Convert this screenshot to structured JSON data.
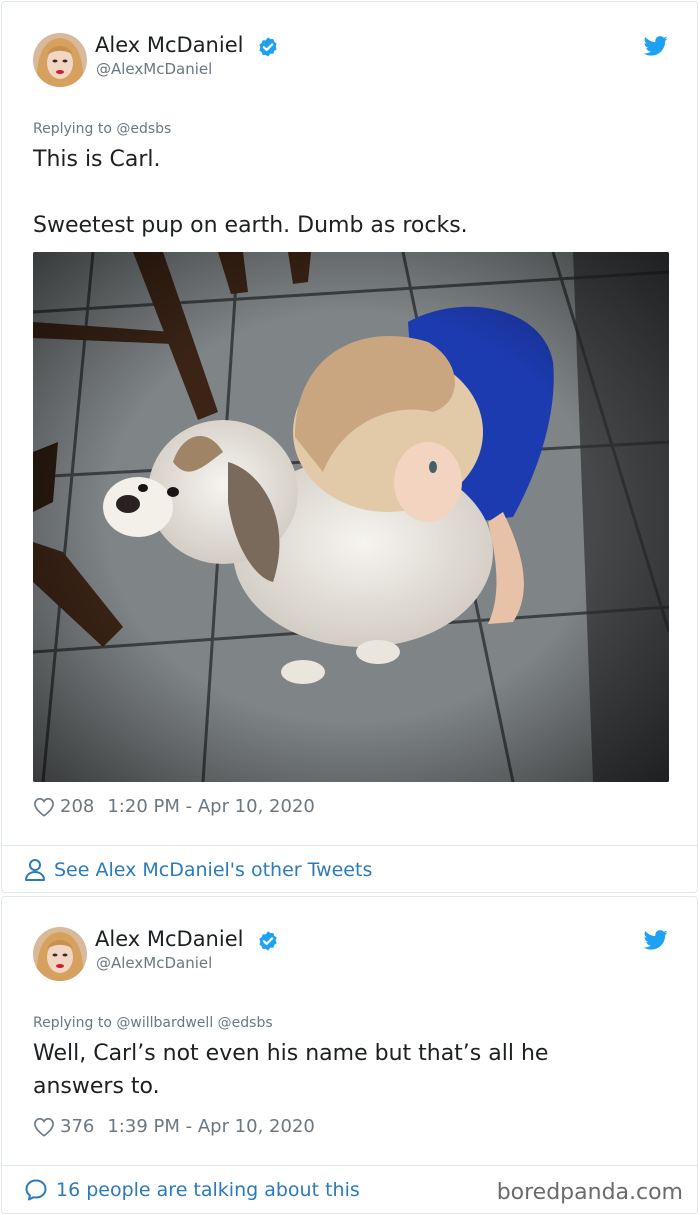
{
  "tweets": [
    {
      "author_name": "Alex McDaniel",
      "handle": "@AlexMcDaniel",
      "replying_to": "Replying to @edsbs",
      "text_line_1": "This is Carl.",
      "text_line_2": "Sweetest pup on earth. Dumb as rocks.",
      "likes": "208",
      "timestamp": "1:20 PM - Apr 10, 2020",
      "footer_link": "See Alex McDaniel's other Tweets"
    },
    {
      "author_name": "Alex McDaniel",
      "handle": "@AlexMcDaniel",
      "replying_to": "Replying to @willbardwell @edsbs",
      "text_line_1": "Well, Carl’s not even his name but that’s all he",
      "text_line_2": "answers to.",
      "likes": "376",
      "timestamp": "1:39 PM - Apr 10, 2020",
      "footer_link": "16 people are talking about this"
    }
  ],
  "watermark": "boredpanda.com",
  "icons": {
    "verified": "verified-badge-icon",
    "bird": "twitter-bird-icon",
    "heart": "heart-icon",
    "person": "person-icon",
    "speech": "speech-bubble-icon"
  },
  "colors": {
    "brand_blue": "#1da1f2",
    "link_blue": "#2b7bb9",
    "meta_gray": "#697882",
    "text": "#1c2022",
    "border": "#e1e8ed"
  }
}
